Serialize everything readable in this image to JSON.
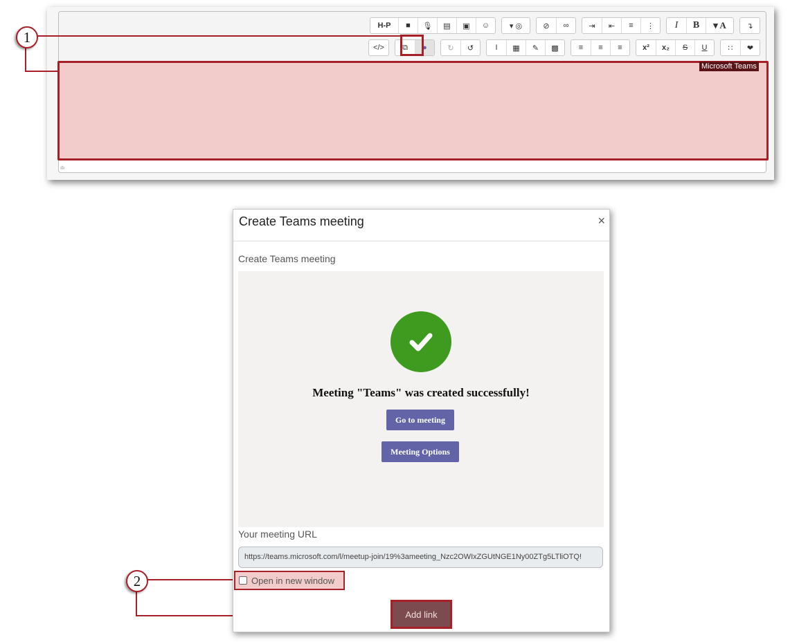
{
  "editor": {
    "toolbar_row1": [
      {
        "group": [
          "H-P",
          "video-icon",
          "mic-icon",
          "file-icon",
          "image-icon",
          "smiley-icon"
        ]
      },
      {
        "group": [
          "dropdown-globe-icon"
        ]
      },
      {
        "group": [
          "unlink-icon",
          "link-icon"
        ]
      },
      {
        "group": [
          "indent-icon",
          "outdent-icon",
          "ordered-list-icon",
          "unordered-list-icon"
        ]
      },
      {
        "group": [
          "I",
          "B",
          "▾ A"
        ]
      },
      {
        "group": [
          "collapse-icon"
        ]
      }
    ],
    "toolbar_row2": [
      {
        "group": [
          "</>"
        ]
      },
      {
        "group": [
          "copy-icon",
          "teams-icon"
        ]
      },
      {
        "group": [
          "redo-icon",
          "undo-icon"
        ]
      },
      {
        "group": [
          "text-cursor-icon",
          "table-icon",
          "edit-icon",
          "calculator-icon"
        ]
      },
      {
        "group": [
          "align-right-icon",
          "align-center-icon",
          "align-left-icon"
        ]
      },
      {
        "group": [
          "x²",
          "x₂",
          "S",
          "U"
        ]
      },
      {
        "group": [
          "special-char-icon",
          "accessibility-icon"
        ]
      }
    ],
    "tooltip": "Microsoft Teams"
  },
  "callouts": {
    "one": "1",
    "two": "2"
  },
  "dialog": {
    "title": "Create Teams meeting",
    "close_label": "×",
    "section_label": "Create Teams meeting",
    "success_message": "Meeting \"Teams\" was created successfully!",
    "go_to_meeting": "Go to meeting",
    "meeting_options": "Meeting Options",
    "url_label": "Your meeting URL",
    "url_value": "https://teams.microsoft.com/l/meetup-join/19%3ameeting_Nzc2OWIxZGUtNGE1Ny00ZTg5LTliOTQ!",
    "checkbox_label": "Open in new window",
    "add_link": "Add link"
  },
  "colors": {
    "highlight_red": "#a81f28",
    "highlight_fill": "#f2cbcb",
    "teams_purple": "#6264a7",
    "success_green": "#3f9b1f"
  }
}
